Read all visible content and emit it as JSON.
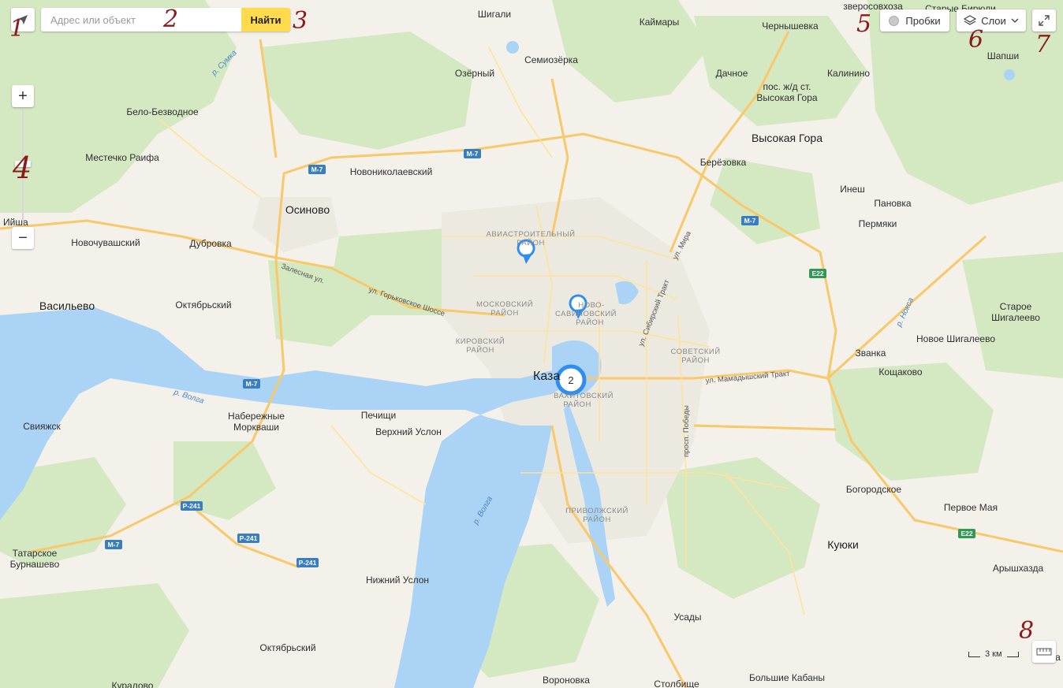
{
  "search": {
    "placeholder": "Адрес или объект",
    "button_label": "Найти"
  },
  "controls": {
    "traffic_label": "Пробки",
    "layers_label": "Слои",
    "zoom_in": "+",
    "zoom_out": "−",
    "scale_label": "3 км"
  },
  "cluster": {
    "count": "2"
  },
  "annotations": [
    "1",
    "2",
    "3",
    "4",
    "5",
    "6",
    "7",
    "8"
  ],
  "places": {
    "shigali": "Шигали",
    "kaymary": "Каймары",
    "chernyshevka": "Чернышевка",
    "zverosovkhoza": "зверосовхоза",
    "starye_biryuli": "Старые Бирюли",
    "shapshi": "Шапши",
    "semiozerka": "Семиозёрка",
    "ozerny": "Озёрный",
    "dachnoe": "Дачное",
    "kalinino": "Калинино",
    "vysokaya_gora_st1": "пос. ж/д ст.",
    "vysokaya_gora_st2": "Высокая Гора",
    "belo_bezvodnoe": "Бело-Безводное",
    "vysokaya_gora": "Высокая Гора",
    "mestechko_raifa": "Местечко Раифа",
    "berezovka": "Берёзовка",
    "novonikolaevsky": "Новониколаевский",
    "osinovo": "Осиново",
    "inesh": "Инеш",
    "panovka": "Пановка",
    "ishi": "Ийша",
    "novochuvashsky": "Новочувашский",
    "dubrovka": "Дубровка",
    "permyaki": "Пермяки",
    "vasilyevo": "Васильево",
    "oktyabrsky1": "Октябрьский",
    "staroe_shigaleevo1": "Старое",
    "staroe_shigaleevo2": "Шигалеево",
    "zvanka": "Званка",
    "novoe_shigaleevo": "Новое Шигалеево",
    "kazan": "Каза",
    "koshchakovo": "Кощаково",
    "sviyazhsk": "Свияжск",
    "naberezhnye1": "Набережные",
    "naberezhnye2": "Моркваши",
    "pechishchi": "Печищи",
    "verkhny_uslon": "Верхний Услон",
    "bogorodskoe": "Богородское",
    "pervoe_maya": "Первое Мая",
    "kuyuki": "Куюки",
    "tatarskoe1": "Татарское",
    "tatarskoe2": "Бурнашево",
    "aryshkhazda": "Арышхазда",
    "nizhny_uslon": "Нижний Услон",
    "usady": "Усады",
    "oktyabrsky2": "Октябрьский",
    "voronovka": "Вороновка",
    "stolbishche": "Столбище",
    "bolshie_kabany": "Большие Кабаны",
    "kuralovo": "Куралово",
    "ka": "Ка"
  },
  "districts": {
    "aviastroitelny1": "АВИАСТРОИТЕЛЬНЫЙ",
    "aviastroitelny2": "РАЙОН",
    "moskovsky1": "МОСКОВСКИЙ",
    "moskovsky2": "РАЙОН",
    "novo_savinovsky1": "НОВО-",
    "novo_savinovsky2": "САВИНОВСКИЙ",
    "novo_savinovsky3": "РАЙОН",
    "kirovsky1": "КИРОВСКИЙ",
    "kirovsky2": "РАЙОН",
    "sovetsky1": "СОВЕТСКИЙ",
    "sovetsky2": "РАЙОН",
    "vakhitovsky1": "ВАХИТОВСКИЙ",
    "vakhitovsky2": "РАЙОН",
    "privolzhsky1": "ПРИВОЛЖСКИЙ",
    "privolzhsky2": "РАЙОН"
  },
  "roads": {
    "m7": "М-7",
    "e22": "E22",
    "r241": "Р-241",
    "zalesnaya": "Залесная ул.",
    "gorkovskoe": "ул. Горьковское Шоссе",
    "sibirsky": "ул. Сибирский Тракт",
    "mira": "ул. Мира",
    "mamadyshsky": "ул. Мамадышский Тракт",
    "pobedy": "просп. Победы"
  },
  "rivers": {
    "sumka": "р. Сумка",
    "volga1": "р. Волга",
    "volga2": "р. Волга",
    "noksa": "р. Нокса"
  },
  "colors": {
    "land": "#f3f1ea",
    "forest": "#d4e8c2",
    "water": "#aad3f5",
    "road_major": "#f9c86b",
    "road_minor": "#ffe39c",
    "urban": "#ece9e0",
    "search_button": "#ffdb4d",
    "marker": "#2e8df0",
    "annotation": "#8b1a1a"
  },
  "icons": {
    "geolocation": "arrow-cursor-icon",
    "traffic": "traffic-dot-icon",
    "layers": "layers-stack-icon",
    "fullscreen": "expand-arrows-icon",
    "ruler": "ruler-icon"
  }
}
